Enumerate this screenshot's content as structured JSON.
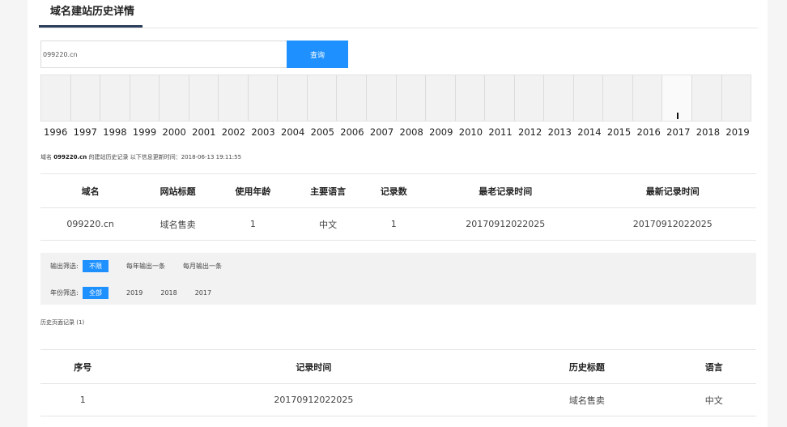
{
  "header": {
    "title": "域名建站历史详情"
  },
  "search": {
    "value": "099220.cn",
    "button_label": "查询"
  },
  "timeline": {
    "years": [
      "1996",
      "1997",
      "1998",
      "1999",
      "2000",
      "2001",
      "2002",
      "2003",
      "2004",
      "2005",
      "2006",
      "2007",
      "2008",
      "2009",
      "2010",
      "2011",
      "2012",
      "2013",
      "2014",
      "2015",
      "2016",
      "2017",
      "2018",
      "2019"
    ],
    "counts": [
      0,
      0,
      0,
      0,
      0,
      0,
      0,
      0,
      0,
      0,
      0,
      0,
      0,
      0,
      0,
      0,
      0,
      0,
      0,
      0,
      0,
      1,
      0,
      0
    ],
    "active_year": "2017"
  },
  "info": {
    "prefix": "域名",
    "domain": "099220.cn",
    "middle": "的建站历史记录 以下信息更新时间：",
    "updated": "2018-06-13 19:11:55"
  },
  "summary": {
    "headers": [
      "域名",
      "网站标题",
      "使用年龄",
      "主要语言",
      "记录数",
      "最老记录时间",
      "最新记录时间"
    ],
    "row": [
      "099220.cn",
      "域名售卖",
      "1",
      "中文",
      "1",
      "20170912022025",
      "20170912022025"
    ]
  },
  "filters": {
    "output_label": "输出筛选:",
    "output_options": [
      "不限",
      "每年输出一条",
      "每月输出一条"
    ],
    "year_label": "年份筛选:",
    "year_options": [
      "全部",
      "2019",
      "2018",
      "2017"
    ]
  },
  "history": {
    "label": "历史页面记录 (1)",
    "headers": [
      "序号",
      "记录时间",
      "历史标题",
      "语言"
    ],
    "rows": [
      [
        "1",
        "20170912022025",
        "域名售卖",
        "中文"
      ]
    ]
  },
  "colors": {
    "accent": "#1e90ff",
    "tab_underline": "#2b3e5c"
  }
}
